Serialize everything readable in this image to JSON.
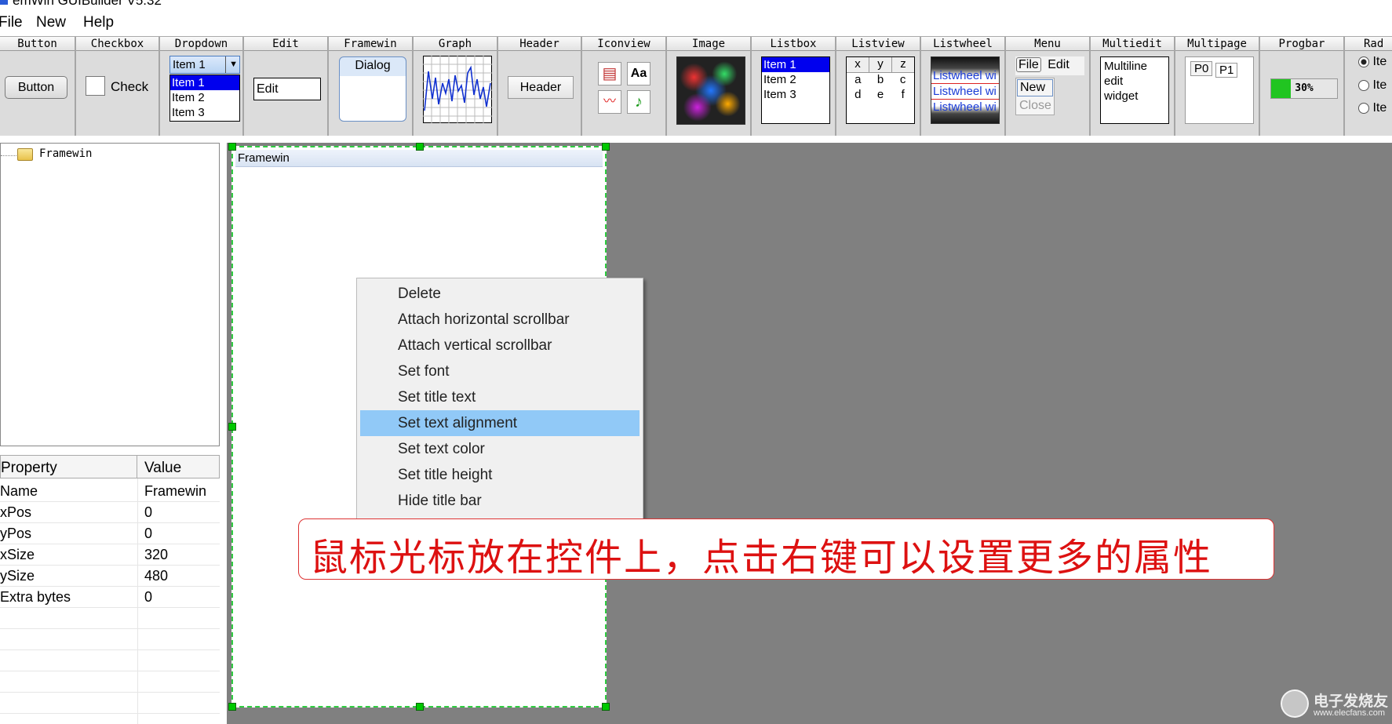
{
  "app": {
    "title": "emWin GUIBuilder V5.32"
  },
  "menubar": {
    "items": [
      "File",
      "New",
      "Help"
    ]
  },
  "palette": {
    "button": {
      "header": "Button",
      "label": "Button"
    },
    "checkbox": {
      "header": "Checkbox",
      "label": "Check"
    },
    "dropdown": {
      "header": "Dropdown",
      "selected": "Item 1",
      "items": [
        "Item 1",
        "Item 2",
        "Item 3"
      ]
    },
    "edit": {
      "header": "Edit",
      "value": "Edit"
    },
    "framewin": {
      "header": "Framewin",
      "label": "Dialog"
    },
    "graph": {
      "header": "Graph"
    },
    "header": {
      "header": "Header",
      "label": "Header"
    },
    "iconview": {
      "header": "Iconview",
      "aa": "Aa"
    },
    "image": {
      "header": "Image"
    },
    "listbox": {
      "header": "Listbox",
      "items": [
        "Item 1",
        "Item 2",
        "Item 3"
      ]
    },
    "listview": {
      "header": "Listview",
      "cols": [
        "x",
        "y",
        "z"
      ],
      "rows": [
        [
          "a",
          "b",
          "c"
        ],
        [
          "d",
          "e",
          "f"
        ]
      ]
    },
    "listwheel": {
      "header": "Listwheel",
      "items": [
        "Listwheel wi",
        "Listwheel wi",
        "Listwheel wi"
      ]
    },
    "menu": {
      "header": "Menu",
      "file": "File",
      "edit": "Edit",
      "new": "New",
      "close": "Close"
    },
    "multiedit": {
      "header": "Multiedit",
      "lines": [
        "Multiline",
        "edit",
        "widget"
      ]
    },
    "multipage": {
      "header": "Multipage",
      "tab0": "P0",
      "tab1": "P1"
    },
    "progbar": {
      "header": "Progbar",
      "text": "30%",
      "value": 0.3
    },
    "radio": {
      "header": "Rad",
      "items": [
        "Ite",
        "Ite",
        "Ite"
      ]
    }
  },
  "tree": {
    "root": "Framewin"
  },
  "properties": {
    "headers": [
      "Property",
      "Value"
    ],
    "rows": [
      [
        "Name",
        "Framewin"
      ],
      [
        "xPos",
        "0"
      ],
      [
        "yPos",
        "0"
      ],
      [
        "xSize",
        "320"
      ],
      [
        "ySize",
        "480"
      ],
      [
        "Extra bytes",
        "0"
      ]
    ]
  },
  "framewin": {
    "title": "Framewin"
  },
  "context_menu": {
    "items": [
      "Delete",
      "Attach horizontal scrollbar",
      "Attach vertical scrollbar",
      "Set font",
      "Set title text",
      "Set text alignment",
      "Set text color",
      "Set title height",
      "Hide title bar"
    ],
    "highlighted": "Set text alignment"
  },
  "annotation": {
    "text": "鼠标光标放在控件上，点击右键可以设置更多的属性"
  },
  "watermark": {
    "text": "电子发烧友",
    "url": "www.elecfans.com"
  },
  "colors": {
    "selection": "#0000ee",
    "highlight": "#91c9f7",
    "handles": "#00c800",
    "annotation": "#dd1111",
    "workspace": "#808080"
  }
}
